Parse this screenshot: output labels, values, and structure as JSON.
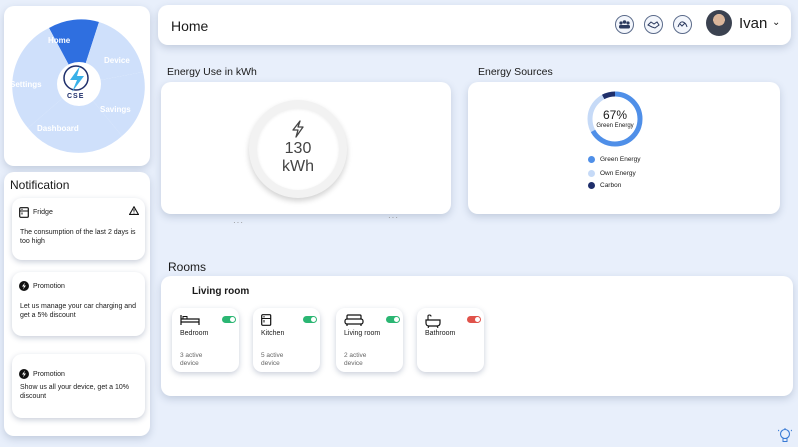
{
  "nav": {
    "items": [
      {
        "label": "Home",
        "active": true
      },
      {
        "label": "Device",
        "active": false
      },
      {
        "label": "Savings",
        "active": false
      },
      {
        "label": "Dashboard",
        "active": false
      },
      {
        "label": "Settings",
        "active": false
      }
    ],
    "logo_text": "CSE"
  },
  "notifications": {
    "title": "Notification",
    "items": [
      {
        "source": "Fridge",
        "message": "The consumption of the last 2 days is too high",
        "icon": "fridge-icon",
        "alert_icon": "warning-icon"
      },
      {
        "source": "Promotion",
        "message": "Let us manage your car charging and get a 5% discount",
        "icon": "bolt-icon"
      },
      {
        "source": "Promotion",
        "message": "Show us all your device, get a 10% discount",
        "icon": "bolt-icon"
      }
    ]
  },
  "header": {
    "title": "Home",
    "icons": [
      "group-icon",
      "handshake-icon",
      "hands-icon"
    ],
    "user": {
      "name": "Ivan",
      "chevron": "⌄"
    }
  },
  "energy_use": {
    "title": "Energy Use in kWh",
    "value": "130",
    "unit": "kWh",
    "icon": "bolt-icon"
  },
  "energy_sources": {
    "title": "Energy Sources",
    "percent_label": "67%",
    "center_label": "Green Energy",
    "chart": {
      "green_energy_fraction": 0.67
    },
    "legend": [
      {
        "label": "Green Energy",
        "color": "#4f8fe8"
      },
      {
        "label": "Own Energy",
        "color": "#c6daf7"
      },
      {
        "label": "Carbon",
        "color": "#1f2f6b"
      }
    ]
  },
  "rooms": {
    "title": "Rooms",
    "group_label": "Living room",
    "items": [
      {
        "name": "Bedroom",
        "count": "3 active",
        "desc": "device",
        "on": true,
        "icon": "bed-icon"
      },
      {
        "name": "Kitchen",
        "count": "5 active",
        "desc": "device",
        "on": true,
        "icon": "fridge-icon"
      },
      {
        "name": "Living room",
        "count": "2 active",
        "desc": "device",
        "on": true,
        "icon": "sofa-icon"
      },
      {
        "name": "Bathroom",
        "count": "",
        "desc": "",
        "on": false,
        "icon": "bathtub-icon"
      }
    ]
  },
  "colors": {
    "accent": "#2f6fe0",
    "nav_light": "#cfe0fb",
    "toggle_on": "#2bb673",
    "toggle_off": "#e0524a"
  },
  "footer": {
    "help_icon": "lightbulb-icon"
  }
}
